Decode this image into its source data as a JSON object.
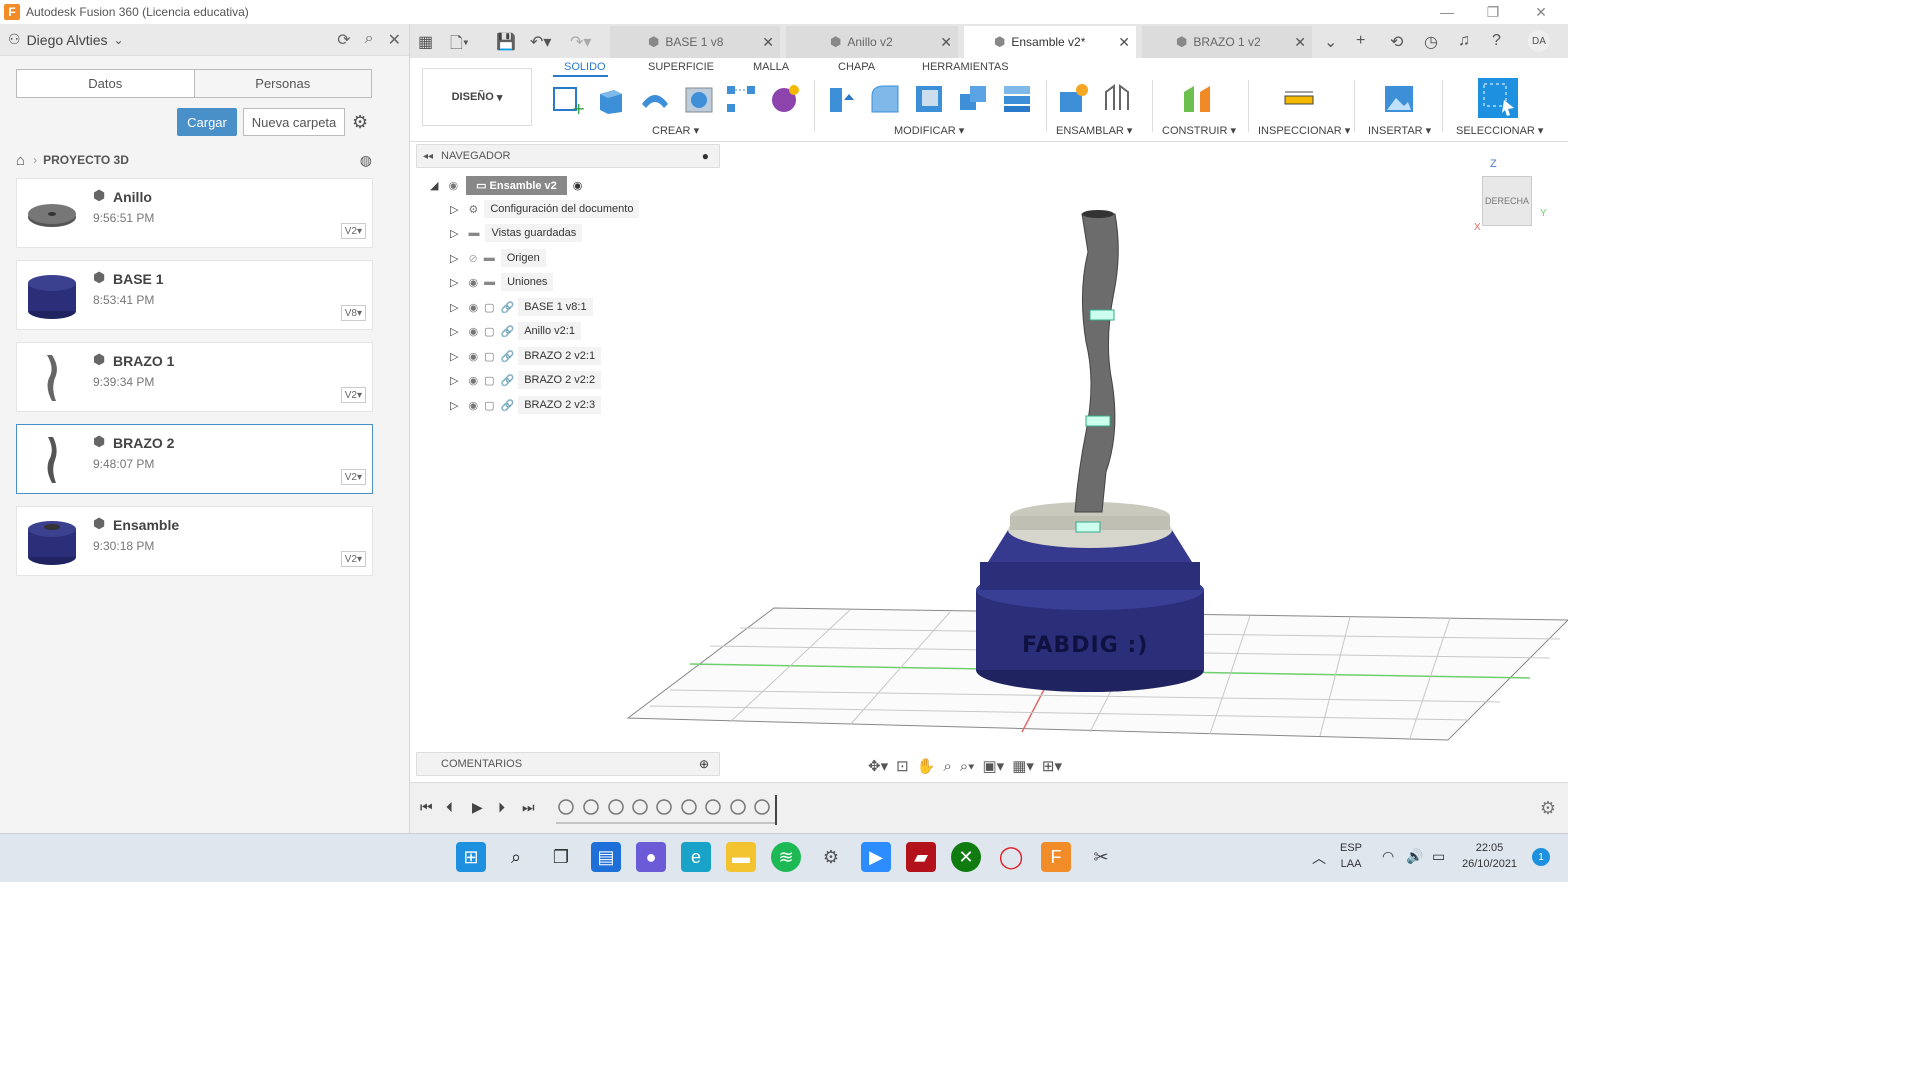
{
  "window": {
    "title": "Autodesk Fusion 360 (Licencia educativa)",
    "app_icon_letter": "F"
  },
  "user": {
    "name": "Diego Alvties"
  },
  "panel": {
    "tab_data": "Datos",
    "tab_people": "Personas",
    "upload_label": "Cargar",
    "new_folder_label": "Nueva carpeta",
    "project": "PROYECTO 3D",
    "files": [
      {
        "name": "Anillo",
        "time": "9:56:51 PM",
        "version": "V2"
      },
      {
        "name": "BASE 1",
        "time": "8:53:41 PM",
        "version": "V8"
      },
      {
        "name": "BRAZO 1",
        "time": "9:39:34 PM",
        "version": "V2"
      },
      {
        "name": "BRAZO 2",
        "time": "9:48:07 PM",
        "version": "V2"
      },
      {
        "name": "Ensamble",
        "time": "9:30:18 PM",
        "version": "V2"
      }
    ]
  },
  "doc_tabs": [
    "BASE 1 v8",
    "Anillo v2",
    "Ensamble v2*",
    "BRAZO 1 v2"
  ],
  "ribbon": {
    "workspace": "DISEÑO",
    "tabs": [
      "SOLIDO",
      "SUPERFICIE",
      "MALLA",
      "CHAPA",
      "HERRAMIENTAS"
    ],
    "groups": [
      "CREAR",
      "MODIFICAR",
      "ENSAMBLAR",
      "CONSTRUIR",
      "INSPECCIONAR",
      "INSERTAR",
      "SELECCIONAR"
    ]
  },
  "navigator": {
    "title": "NAVEGADOR",
    "root": "Ensamble v2",
    "items": [
      "Configuración del documento",
      "Vistas guardadas",
      "Origen",
      "Uniones",
      "BASE 1 v8:1",
      "Anillo v2:1",
      "BRAZO 2 v2:1",
      "BRAZO 2 v2:2",
      "BRAZO 2 v2:3"
    ]
  },
  "comments": {
    "title": "COMENTARIOS"
  },
  "viewcube": {
    "face": "DERECHA",
    "z": "Z",
    "y": "Y",
    "x": "X"
  },
  "model": {
    "engraving": "FABDIG :)"
  },
  "user_initials": "DA",
  "tray": {
    "lang1": "ESP",
    "lang2": "LAA",
    "time": "22:05",
    "date": "26/10/2021",
    "notif": "1"
  },
  "colors": {
    "accent": "#2b7ac9",
    "model_blue": "#2b2f7a",
    "upload_btn": "#4a90c8"
  }
}
